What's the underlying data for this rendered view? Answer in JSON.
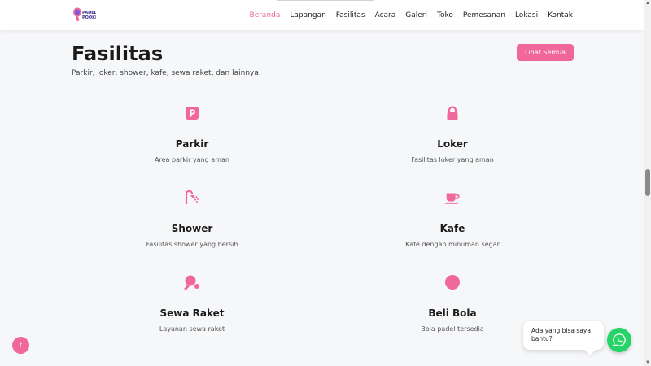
{
  "brand": {
    "logo_text": "PADEL POOKIE",
    "logo_icon": "racket-logo-icon",
    "accent": "#f0679b"
  },
  "nav": {
    "items": [
      {
        "label": "Beranda",
        "active": true
      },
      {
        "label": "Lapangan",
        "active": false
      },
      {
        "label": "Fasilitas",
        "active": false
      },
      {
        "label": "Acara",
        "active": false
      },
      {
        "label": "Galeri",
        "active": false
      },
      {
        "label": "Toko",
        "active": false
      },
      {
        "label": "Pemesanan",
        "active": false
      },
      {
        "label": "Lokasi",
        "active": false
      },
      {
        "label": "Kontak",
        "active": false
      }
    ]
  },
  "section": {
    "title": "Fasilitas",
    "subtitle": "Parkir, loker, shower, kafe, sewa raket, dan lainnya.",
    "see_all_label": "Lihat Semua"
  },
  "facilities": [
    {
      "icon": "parking-icon",
      "title": "Parkir",
      "desc": "Area parkir yang aman"
    },
    {
      "icon": "lock-icon",
      "title": "Loker",
      "desc": "Fasilitas loker yang aman"
    },
    {
      "icon": "shower-icon",
      "title": "Shower",
      "desc": "Fasilitas shower yang bersih"
    },
    {
      "icon": "coffee-cup-icon",
      "title": "Kafe",
      "desc": "Kafe dengan minuman segar"
    },
    {
      "icon": "racket-icon",
      "title": "Sewa Raket",
      "desc": "Layanan sewa raket"
    },
    {
      "icon": "ball-icon",
      "title": "Beli Bola",
      "desc": "Bola padel tersedia"
    }
  ],
  "chat": {
    "message": "Ada yang bisa saya bantu?",
    "icon": "whatsapp-icon",
    "color": "#25d366"
  },
  "back_to_top": {
    "icon": "arrow-up-icon",
    "glyph": "↑"
  }
}
